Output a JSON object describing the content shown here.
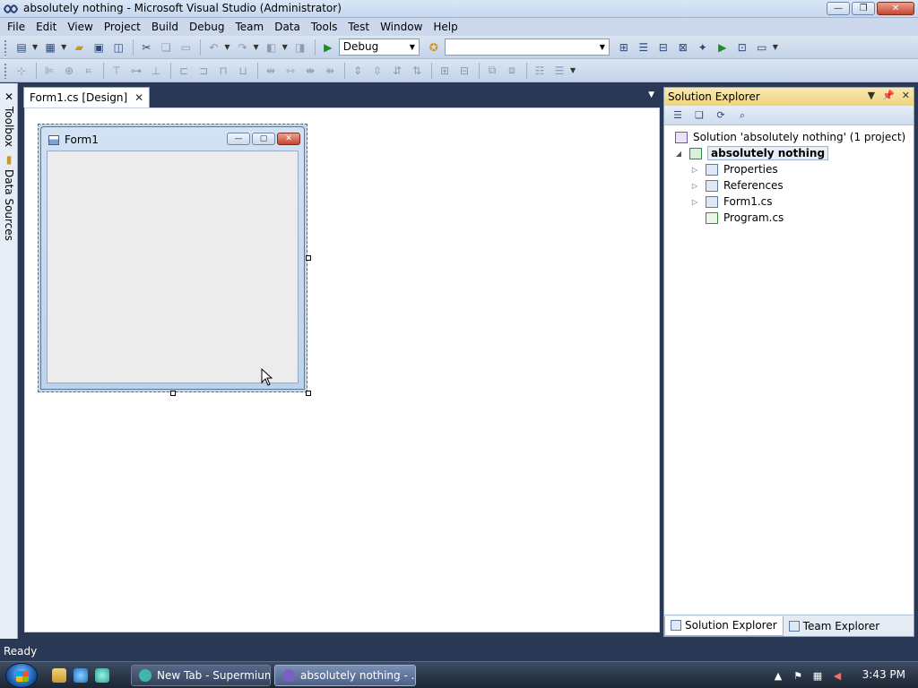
{
  "window": {
    "title": "absolutely nothing - Microsoft Visual Studio (Administrator)"
  },
  "window_buttons": {
    "minimize": "—",
    "restore": "❐",
    "close": "✕"
  },
  "menu": [
    "File",
    "Edit",
    "View",
    "Project",
    "Build",
    "Debug",
    "Team",
    "Data",
    "Tools",
    "Test",
    "Window",
    "Help"
  ],
  "toolbar": {
    "config_value": "Debug",
    "platform_value": "",
    "buttons": [
      "new-project",
      "add-item",
      "open-file",
      "save",
      "save-all",
      "cut",
      "copy",
      "paste",
      "undo",
      "redo",
      "navigate-back",
      "navigate-forward",
      "start-debugging",
      "find-in-files",
      "solution-explorer",
      "properties",
      "object-browser",
      "toolbox",
      "extension-manager",
      "command-window",
      "class-view",
      "immediate-window"
    ]
  },
  "layout_toolbar": {
    "buttons": [
      "align-to-grid",
      "align-lefts",
      "align-centers",
      "align-rights",
      "align-tops",
      "align-middles",
      "align-bottoms",
      "make-same-width",
      "size-to-grid",
      "make-same-height",
      "make-same-size",
      "horizontal-spacing",
      "increase-h-spacing",
      "decrease-h-spacing",
      "remove-h-spacing",
      "vertical-spacing",
      "increase-v-spacing",
      "decrease-v-spacing",
      "remove-v-spacing",
      "center-horizontally",
      "center-vertically",
      "bring-to-front",
      "send-to-back",
      "tab-order",
      "lock-controls"
    ]
  },
  "side_tabs": {
    "toolbox": "Toolbox",
    "data_sources": "Data Sources"
  },
  "document_tab": {
    "label": "Form1.cs [Design]",
    "close": "✕"
  },
  "form": {
    "title": "Form1"
  },
  "solution_explorer": {
    "title": "Solution Explorer",
    "tree": {
      "solution": "Solution 'absolutely nothing' (1 project)",
      "project": "absolutely nothing",
      "properties": "Properties",
      "references": "References",
      "form1": "Form1.cs",
      "program": "Program.cs"
    },
    "tabs": {
      "solution_explorer": "Solution Explorer",
      "team_explorer": "Team Explorer"
    }
  },
  "status": {
    "text": "Ready"
  },
  "taskbar": {
    "items": [
      {
        "label": "New Tab - Supermium",
        "color": "#3fb6a8"
      },
      {
        "label": "absolutely nothing - ...",
        "color": "#7b5fc2"
      }
    ],
    "clock": "3:43 PM"
  },
  "colors": {
    "accent": "#293955",
    "header": "#f0d57b",
    "start": "#1e5fb3"
  }
}
